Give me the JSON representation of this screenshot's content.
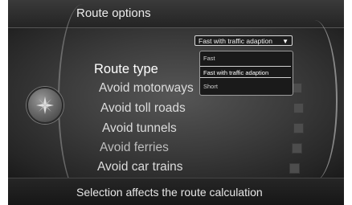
{
  "header": {
    "title": "Route options"
  },
  "menu": {
    "items": [
      {
        "label": "Route type"
      },
      {
        "label": "Avoid motorways"
      },
      {
        "label": "Avoid toll roads"
      },
      {
        "label": "Avoid tunnels"
      },
      {
        "label": "Avoid ferries"
      },
      {
        "label": "Avoid car trains"
      }
    ]
  },
  "route_type": {
    "selected": "Fast with traffic adaption",
    "options": [
      "Fast",
      "Fast with traffic adaption",
      "Short"
    ]
  },
  "footer": {
    "text": "Selection affects the route calculation"
  },
  "icons": {
    "knob": "navigation-knob-icon",
    "dropdown": "dropdown-arrow-icon"
  }
}
